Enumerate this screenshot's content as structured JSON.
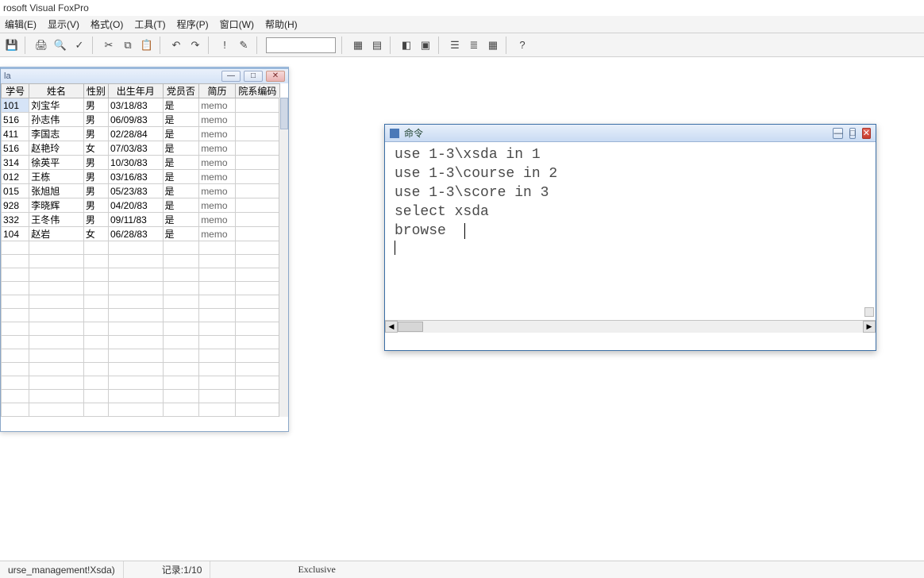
{
  "app": {
    "title": "rosoft Visual FoxPro"
  },
  "menus": {
    "edit": "编辑(E)",
    "view": "显示(V)",
    "format": "格式(O)",
    "tools": "工具(T)",
    "program": "程序(P)",
    "window": "窗口(W)",
    "help": "帮助(H)"
  },
  "toolbar_icons": {
    "save": "💾",
    "print": "🖨",
    "preview": "🔍",
    "spell": "✓",
    "cut": "✂",
    "copy": "⧉",
    "paste": "📋",
    "undo": "↶",
    "redo": "↷",
    "run": "!",
    "modify": "✎",
    "db1": "▦",
    "db2": "▤",
    "db3": "◧",
    "form": "▣",
    "report": "☰",
    "g1": "≣",
    "g2": "▦",
    "help": "?"
  },
  "browse": {
    "title": "la",
    "min": "—",
    "max": "□",
    "close": "✕",
    "columns": [
      "学号",
      "姓名",
      "性别",
      "出生年月",
      "党员否",
      "简历",
      "院系编码"
    ],
    "rows": [
      {
        "id": "101",
        "name": "刘宝华",
        "sex": "男",
        "dob": "03/18/83",
        "party": "是",
        "memo": "memo",
        "dept": ""
      },
      {
        "id": "516",
        "name": "孙志伟",
        "sex": "男",
        "dob": "06/09/83",
        "party": "是",
        "memo": "memo",
        "dept": ""
      },
      {
        "id": "411",
        "name": "李国志",
        "sex": "男",
        "dob": "02/28/84",
        "party": "是",
        "memo": "memo",
        "dept": ""
      },
      {
        "id": "516",
        "name": "赵艳玲",
        "sex": "女",
        "dob": "07/03/83",
        "party": "是",
        "memo": "memo",
        "dept": ""
      },
      {
        "id": "314",
        "name": "徐英平",
        "sex": "男",
        "dob": "10/30/83",
        "party": "是",
        "memo": "memo",
        "dept": ""
      },
      {
        "id": "012",
        "name": "王栋",
        "sex": "男",
        "dob": "03/16/83",
        "party": "是",
        "memo": "memo",
        "dept": ""
      },
      {
        "id": "015",
        "name": "张旭旭",
        "sex": "男",
        "dob": "05/23/83",
        "party": "是",
        "memo": "memo",
        "dept": ""
      },
      {
        "id": "928",
        "name": "李晓辉",
        "sex": "男",
        "dob": "04/20/83",
        "party": "是",
        "memo": "memo",
        "dept": ""
      },
      {
        "id": "332",
        "name": "王冬伟",
        "sex": "男",
        "dob": "09/11/83",
        "party": "是",
        "memo": "memo",
        "dept": ""
      },
      {
        "id": "104",
        "name": "赵岩",
        "sex": "女",
        "dob": "06/28/83",
        "party": "是",
        "memo": "memo",
        "dept": ""
      }
    ]
  },
  "command": {
    "title": "命令",
    "min": "—",
    "max": "□",
    "close": "✕",
    "lines": [
      "use 1-3\\xsda in 1",
      "use 1-3\\course in 2",
      "use 1-3\\score in 3",
      "select xsda",
      "browse"
    ],
    "hleft": "◀",
    "hright": "▶"
  },
  "status": {
    "source": "urse_management!Xsda)",
    "rec_label": "记录:",
    "rec_value": "1/10",
    "excl": "Exclusive"
  }
}
